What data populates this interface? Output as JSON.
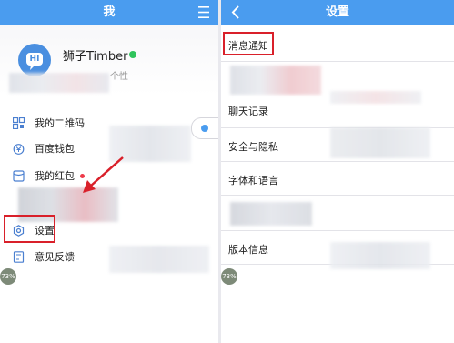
{
  "left": {
    "title": "我",
    "username": "狮子Timber",
    "signature": "个性",
    "avatar_text": "HI",
    "menu": [
      {
        "label": "我的二维码",
        "icon": "qr-code-icon"
      },
      {
        "label": "百度钱包",
        "icon": "wallet-icon"
      },
      {
        "label": "我的红包",
        "icon": "red-envelope-icon"
      },
      {
        "label": "设置",
        "icon": "settings-icon"
      },
      {
        "label": "意见反馈",
        "icon": "feedback-icon"
      }
    ],
    "badge": "73%"
  },
  "right": {
    "title": "设置",
    "rows": [
      {
        "label": "消息通知"
      },
      {
        "label": ""
      },
      {
        "label": "聊天记录"
      },
      {
        "label": "安全与隐私"
      },
      {
        "label": "字体和语言"
      },
      {
        "label": ""
      },
      {
        "label": "版本信息"
      }
    ],
    "badge": "73%"
  },
  "colors": {
    "accent": "#4a9cef",
    "highlight": "#d9202a",
    "online": "#30c45c"
  }
}
